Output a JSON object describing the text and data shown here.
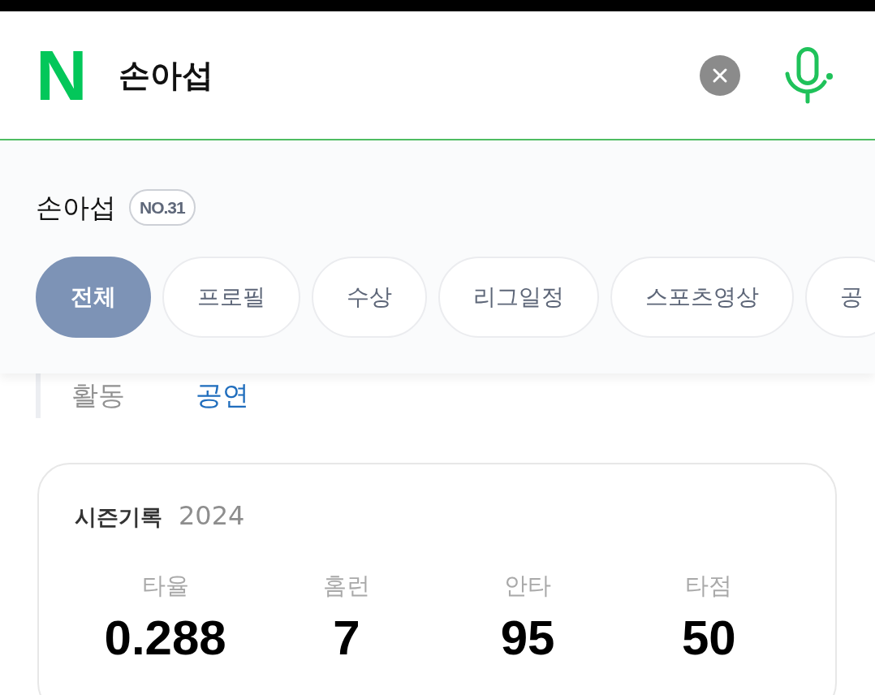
{
  "search": {
    "logo": "N",
    "value": "손아섭"
  },
  "profile": {
    "name": "손아섭",
    "badge": "NO.31"
  },
  "tabs": [
    {
      "label": "전체",
      "selected": true
    },
    {
      "label": "프로필",
      "selected": false
    },
    {
      "label": "수상",
      "selected": false
    },
    {
      "label": "리그일정",
      "selected": false
    },
    {
      "label": "스포츠영상",
      "selected": false
    },
    {
      "label": "공",
      "selected": false
    }
  ],
  "activity": {
    "label": "활동",
    "link": "공연"
  },
  "season_record": {
    "title": "시즌기록",
    "year": "2024",
    "stats": [
      {
        "label": "타율",
        "value": "0.288"
      },
      {
        "label": "홈런",
        "value": "7"
      },
      {
        "label": "안타",
        "value": "95"
      },
      {
        "label": "타점",
        "value": "50"
      }
    ]
  }
}
